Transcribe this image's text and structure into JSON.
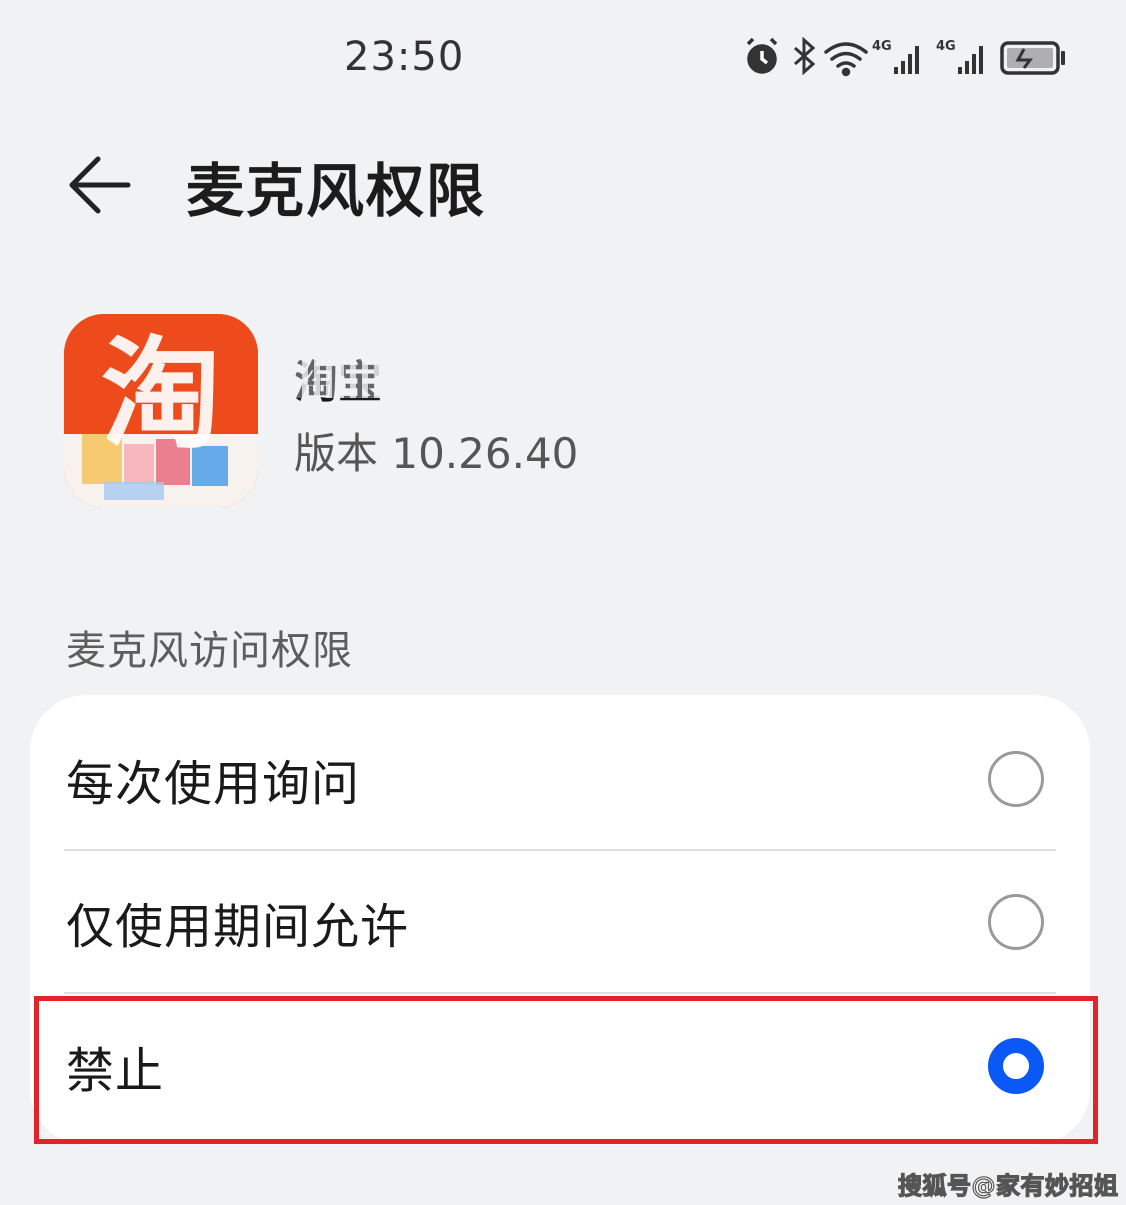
{
  "status_bar": {
    "time": "23:50",
    "icons": [
      "alarm-icon",
      "bluetooth-icon",
      "wifi-icon",
      "signal-4g-icon",
      "signal-4g-icon",
      "battery-charging-icon"
    ],
    "network_label_1": "4G",
    "network_label_2": "4G"
  },
  "header": {
    "back_icon": "arrow-left-icon",
    "title": "麦克风权限"
  },
  "app": {
    "name": "淘宝",
    "version": "版本 10.26.40",
    "icon_text": "淘",
    "icon_color": "#f0501e"
  },
  "permission": {
    "section_label": "麦克风访问权限",
    "options": [
      {
        "label": "每次使用询问",
        "selected": false
      },
      {
        "label": "仅使用期间允许",
        "selected": false
      },
      {
        "label": "禁止",
        "selected": true
      }
    ]
  },
  "colors": {
    "accent": "#0a59f7",
    "highlight": "#e3222a",
    "background": "#f1f2f4"
  },
  "watermark": "搜狐号@家有妙招姐"
}
